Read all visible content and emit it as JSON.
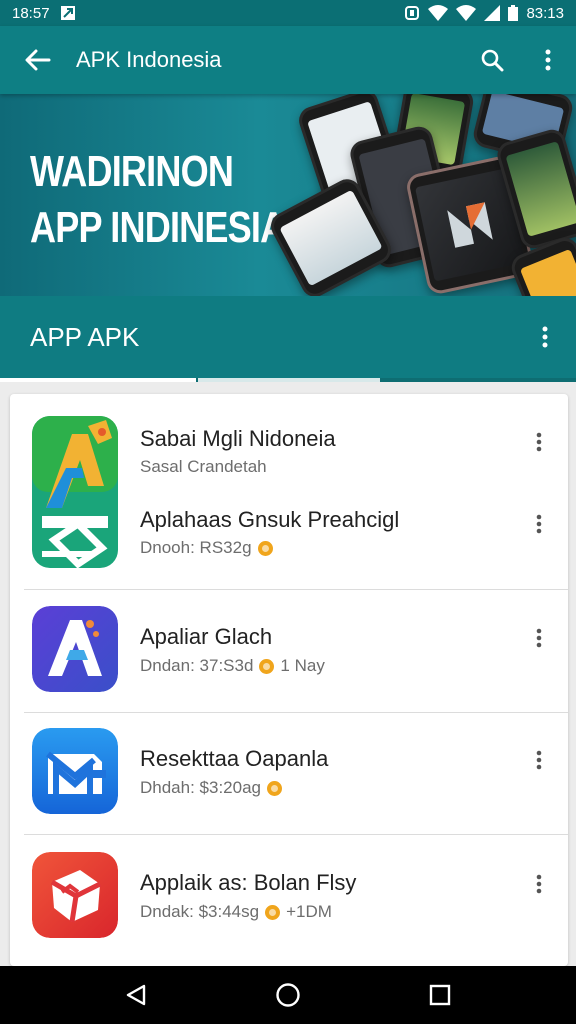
{
  "status_bar": {
    "time": "18:57",
    "battery_pct": "83:13",
    "icons": [
      "sim-card-icon",
      "nfc-icon",
      "wifi-icon",
      "wifi-icon",
      "signal-icon",
      "battery-icon"
    ]
  },
  "app_bar": {
    "title": "APK Indonesia",
    "back_icon": "arrow-left-icon",
    "search_icon": "search-icon",
    "menu_icon": "more-vert-icon"
  },
  "hero": {
    "line1": "WADIRINON",
    "line2": "APP INDINESIA"
  },
  "section": {
    "label": "APP APK",
    "menu_icon": "more-vert-icon",
    "tab_progress": 0.34
  },
  "list": {
    "items": [
      {
        "name": "Sabai Mgli Nidoneia",
        "subtitle": "Sasal Crandetah",
        "price": "",
        "extra": "",
        "icon": "letter-a-green-icon"
      },
      {
        "name": "Aplahaas Gnsuk Preahcigl",
        "subtitle": "Dnooh: RS32g",
        "price": "",
        "extra": "",
        "icon": ""
      },
      {
        "name": "Apaliar Glach",
        "subtitle": "Dndan: 37:S3d",
        "price": "",
        "extra": "1 Nay",
        "icon": "letter-a-purple-icon"
      },
      {
        "name": "Resekttaa Oapanla",
        "subtitle": "Dhdah: $3:20ag",
        "price": "",
        "extra": "",
        "icon": "mail-blue-icon"
      },
      {
        "name": "Applaik as: Bolan Flsy",
        "subtitle": "Dndak: $3:44sg",
        "price": "",
        "extra": "+1DM",
        "icon": "cube-red-icon"
      }
    ]
  },
  "nav_bar": {
    "back": "nav-back-icon",
    "home": "nav-home-icon",
    "recents": "nav-recents-icon"
  }
}
